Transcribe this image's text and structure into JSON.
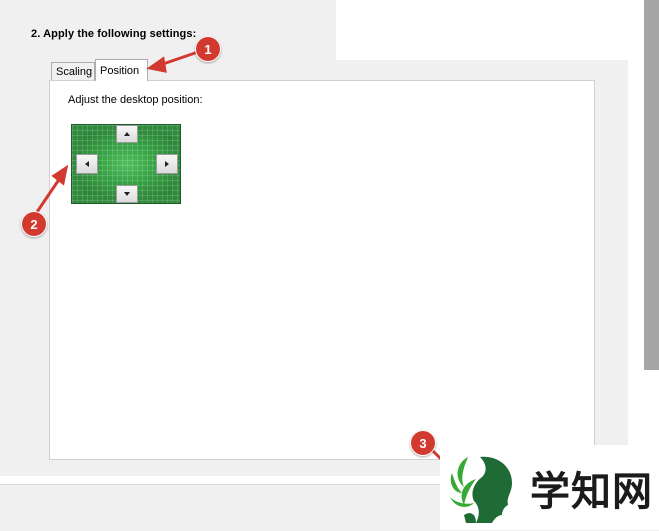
{
  "section": {
    "heading": "2. Apply the following settings:"
  },
  "tabs": [
    {
      "label": "Scaling",
      "selected": false
    },
    {
      "label": "Position",
      "selected": true
    }
  ],
  "position_tab": {
    "instruction": "Adjust the desktop position:",
    "buttons": {
      "up": "arrow-up",
      "down": "arrow-down",
      "left": "arrow-left",
      "right": "arrow-right"
    }
  },
  "callouts": [
    "1",
    "2",
    "3"
  ],
  "watermark": {
    "text": "学知网"
  },
  "colors": {
    "callout": "#d23a2f",
    "panel": "#f0f0f0",
    "position_preview": "#2f8a3e",
    "scrollbar": "#a6a6a6"
  }
}
